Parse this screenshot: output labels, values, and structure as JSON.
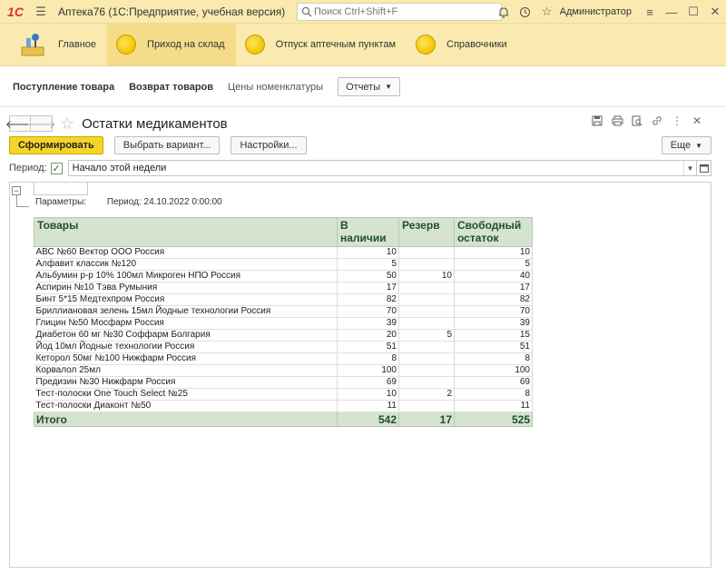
{
  "app": {
    "logo": "1С",
    "title": "Аптека76  (1С:Предприятие, учебная версия)",
    "search_placeholder": "Поиск Ctrl+Shift+F",
    "user": "Администратор"
  },
  "sections": [
    {
      "label": "Главное",
      "icon": "home-icon"
    },
    {
      "label": "Приход на склад",
      "icon": "yellow-circle-icon"
    },
    {
      "label": "Отпуск аптечным пунктам",
      "icon": "yellow-circle-icon"
    },
    {
      "label": "Справочники",
      "icon": "yellow-circle-icon"
    }
  ],
  "func_panel": {
    "link1": "Поступление товара",
    "link2": "Возврат товаров",
    "link3": "Цены номенклатуры",
    "reports": "Отчеты"
  },
  "form": {
    "title": "Остатки медикаментов",
    "generate": "Сформировать",
    "choose_variant": "Выбрать вариант...",
    "settings": "Настройки...",
    "more": "Еще",
    "period_label": "Период:",
    "period_value": "Начало этой недели"
  },
  "report": {
    "params_label": "Параметры:",
    "params_value": "Период: 24.10.2022 0:00:00",
    "headers": {
      "goods": "Товары",
      "in_stock_1": "В",
      "in_stock_2": "наличии",
      "reserve": "Резерв",
      "free_1": "Свободный",
      "free_2": "остаток"
    },
    "rows": [
      {
        "name": "АВС №60 Вектор ООО Россия",
        "stock": "10",
        "reserve": "",
        "free": "10"
      },
      {
        "name": "Алфавит классик №120",
        "stock": "5",
        "reserve": "",
        "free": "5"
      },
      {
        "name": "Альбумин р-р 10% 100мл Микроген НПО Россия",
        "stock": "50",
        "reserve": "10",
        "free": "40"
      },
      {
        "name": "Аспирин №10 Тэва Румыния",
        "stock": "17",
        "reserve": "",
        "free": "17"
      },
      {
        "name": "Бинт 5*15 Медтехпром Россия",
        "stock": "82",
        "reserve": "",
        "free": "82"
      },
      {
        "name": "Бриллиановая зелень 15мл Йодные технологии Россия",
        "stock": "70",
        "reserve": "",
        "free": "70"
      },
      {
        "name": "Глицин №50 Мосфарм Россия",
        "stock": "39",
        "reserve": "",
        "free": "39"
      },
      {
        "name": "Диабетон 60 мг №30 Соффарм Болгария",
        "stock": "20",
        "reserve": "5",
        "free": "15"
      },
      {
        "name": "Йод 10мл Йодные технологии Россия",
        "stock": "51",
        "reserve": "",
        "free": "51"
      },
      {
        "name": "Кеторол 50мг №100 Нижфарм Россия",
        "stock": "8",
        "reserve": "",
        "free": "8"
      },
      {
        "name": "Корвалол 25мл",
        "stock": "100",
        "reserve": "",
        "free": "100"
      },
      {
        "name": "Предизин №30 Нижфарм Россия",
        "stock": "69",
        "reserve": "",
        "free": "69"
      },
      {
        "name": "Тест-полоски One Touch Select №25",
        "stock": "10",
        "reserve": "2",
        "free": "8"
      },
      {
        "name": "Тест-полоски Диаконт №50",
        "stock": "11",
        "reserve": "",
        "free": "11"
      }
    ],
    "total": {
      "label": "Итого",
      "stock": "542",
      "reserve": "17",
      "free": "525"
    }
  }
}
